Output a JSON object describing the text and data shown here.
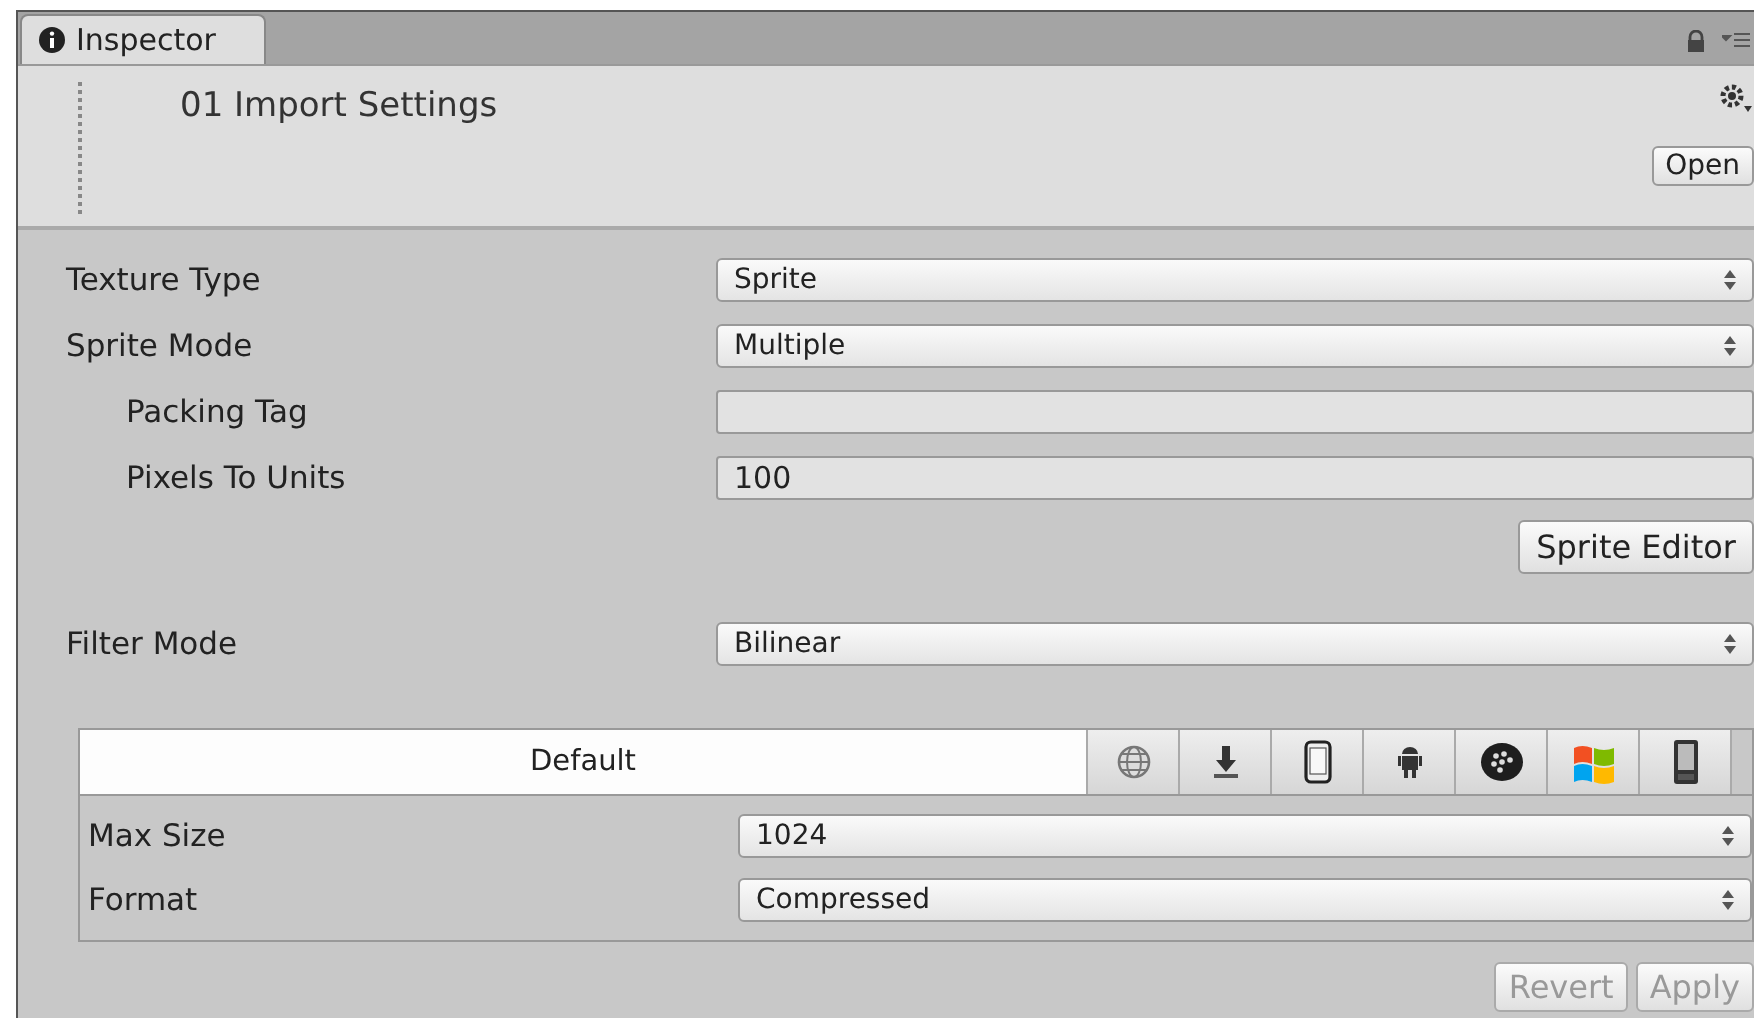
{
  "tab": {
    "title": "Inspector",
    "selected": true
  },
  "header": {
    "title": "01 Import Settings",
    "open_button": "Open"
  },
  "fields": [
    {
      "kind": "dropdown",
      "label": "Texture Type",
      "value": "Sprite"
    },
    {
      "kind": "dropdown",
      "label": "Sprite Mode",
      "value": "Multiple",
      "children": [
        {
          "kind": "text",
          "label": "Packing Tag"
        },
        {
          "kind": "text",
          "label": "Pixels To Units",
          "value": "100"
        }
      ]
    },
    {
      "kind": "button",
      "label": "Sprite Editor"
    },
    {
      "kind": "dropdown",
      "label": "Filter Mode",
      "value": "Bilinear"
    }
  ],
  "platform_tabs": [
    {
      "label": "Default",
      "selected": true
    },
    {
      "selected": false
    },
    {
      "selected": false
    },
    {
      "selected": false
    },
    {
      "selected": false
    },
    {
      "selected": false
    },
    {
      "selected": false
    },
    {
      "selected": false
    }
  ],
  "platform_fields": [
    {
      "kind": "dropdown",
      "label": "Max Size",
      "value": "1024"
    },
    {
      "kind": "dropdown",
      "label": "Format",
      "value": "Compressed"
    }
  ],
  "buttons": [
    {
      "label": "Revert",
      "disabled": true
    },
    {
      "label": "Apply",
      "disabled": true
    }
  ]
}
